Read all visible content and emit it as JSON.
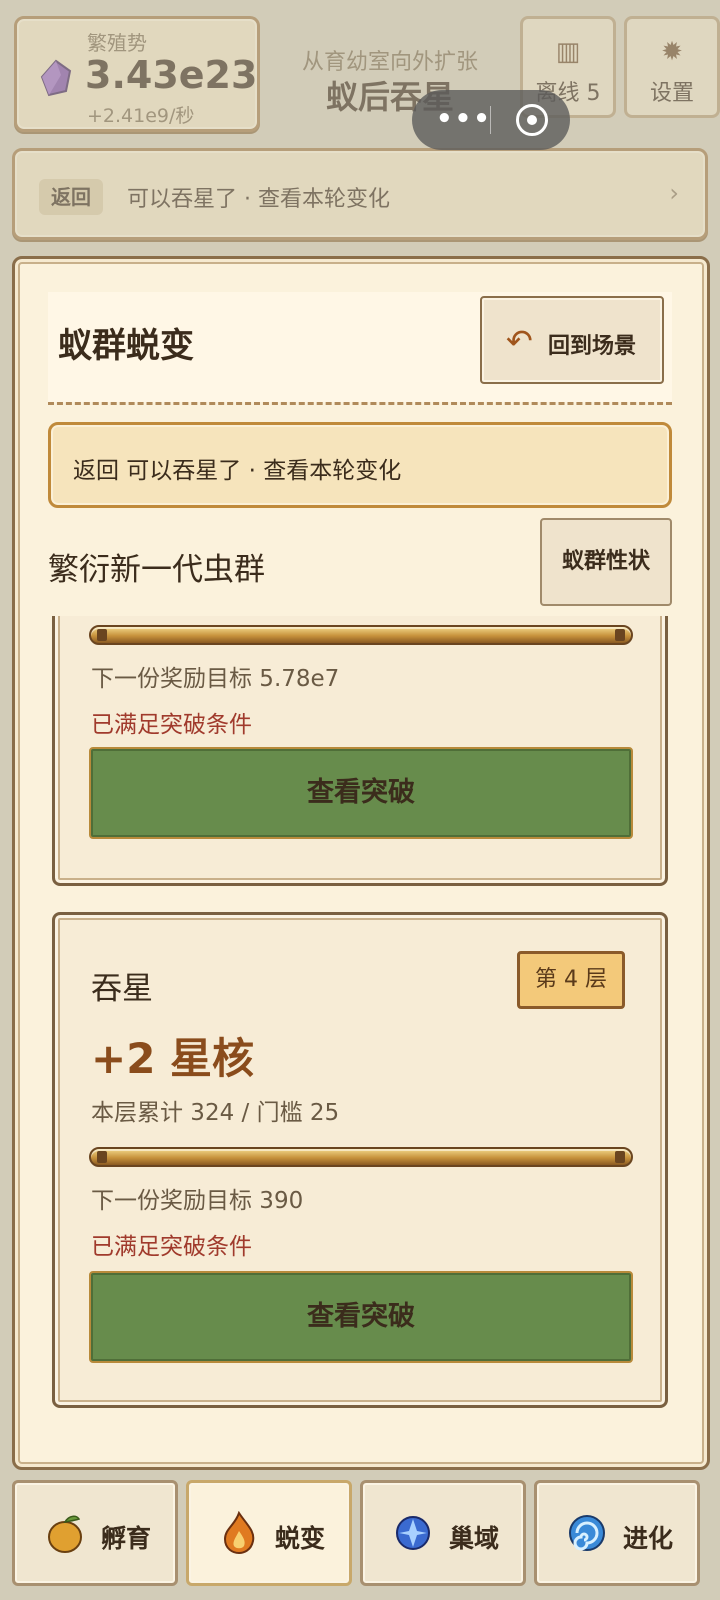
{
  "hud": {
    "resource_name": "繁殖势",
    "resource_value": "3.43e23",
    "resource_rate": "+2.41e9/秒",
    "stage_subtitle": "从育幼室向外扩张",
    "stage_title": "蚁后吞星",
    "offline_label": "离线 5",
    "settings_label": "设置",
    "banner_back": "返回",
    "banner_text": "可以吞星了 · 查看本轮变化",
    "banner_chevron": "›"
  },
  "capsule": {
    "dots": "•••"
  },
  "modal": {
    "title": "蚁群蜕变",
    "back_scene_label": "回到场景",
    "notice": "返回 可以吞星了 · 查看本轮变化",
    "section_title": "繁衍新一代虫群",
    "traits_label": "蚁群性状"
  },
  "cards": [
    {
      "next_goal": "下一份奖励目标 5.78e7",
      "status": "已满足突破条件",
      "button": "查看突破",
      "progress": 1.0
    },
    {
      "name": "吞星",
      "layer": "第 4 层",
      "reward": "+2 星核",
      "accum": "本层累计 324 / 门槛 25",
      "next_goal": "下一份奖励目标 390",
      "status": "已满足突破条件",
      "button": "查看突破",
      "progress": 1.0
    }
  ],
  "nav": [
    {
      "label": "孵育",
      "icon": "fruit-icon",
      "active": false
    },
    {
      "label": "蜕变",
      "icon": "flame-icon",
      "active": true
    },
    {
      "label": "巢域",
      "icon": "crystal-icon",
      "active": false
    },
    {
      "label": "进化",
      "icon": "swirl-icon",
      "active": false
    }
  ],
  "colors": {
    "modal_bg": "#fbf2dc",
    "button_green": "#678c4c",
    "status_red": "#a03a2c",
    "reward_brown": "#8a4c1c"
  }
}
